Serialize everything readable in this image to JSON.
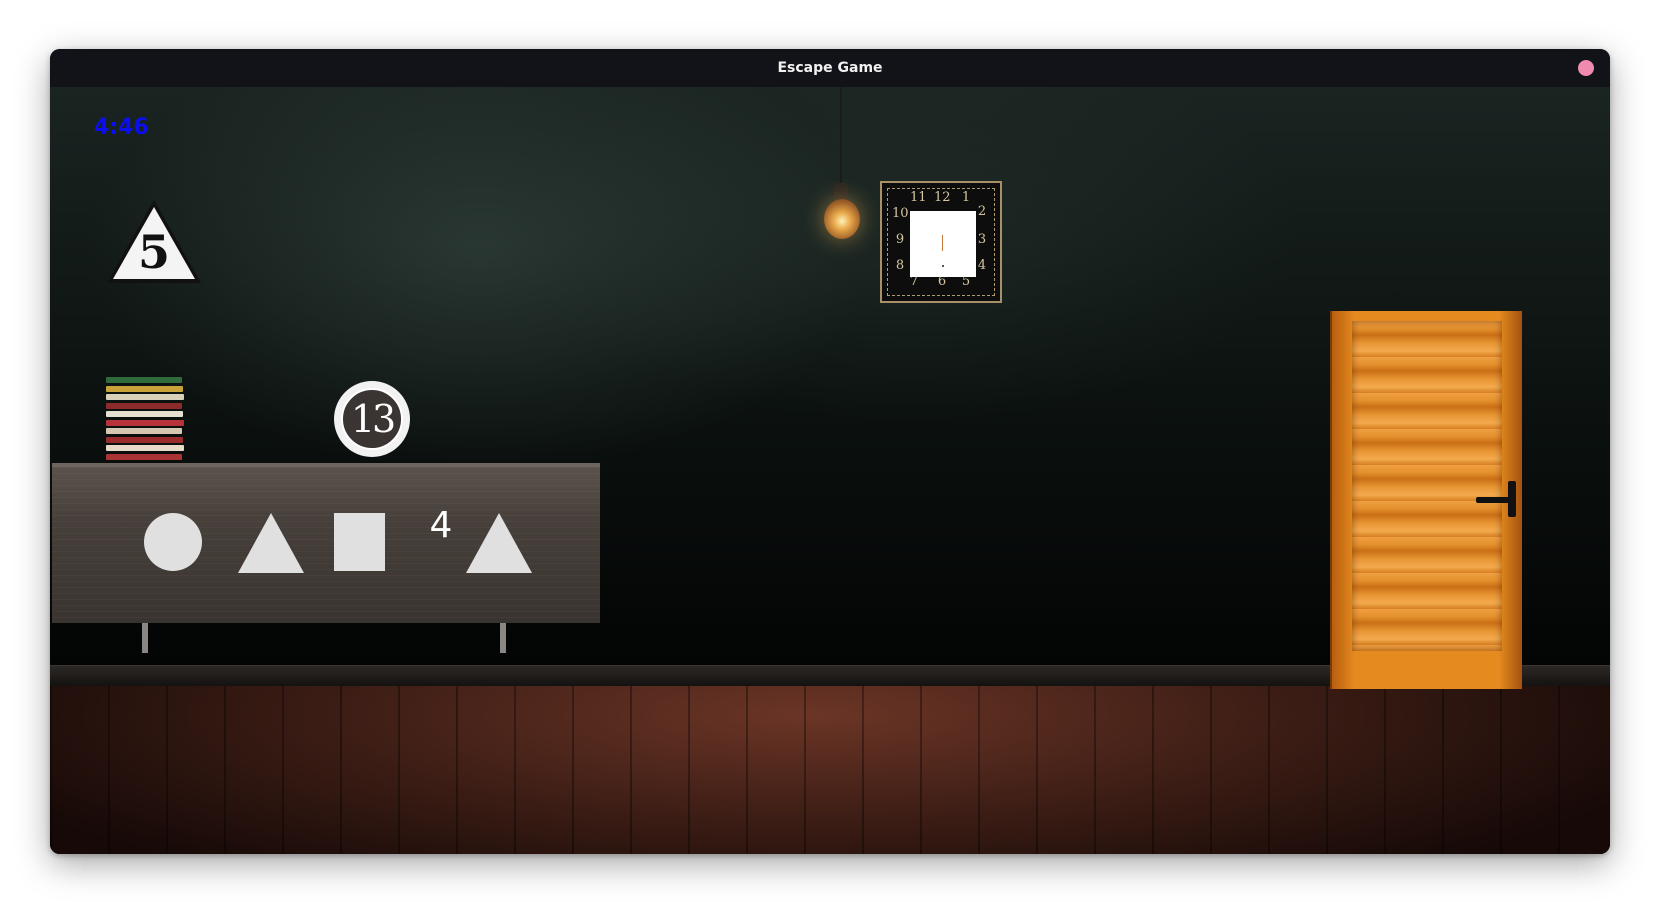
{
  "window": {
    "title": "Escape Game"
  },
  "hud": {
    "timer": "4:46"
  },
  "scene": {
    "triangle_sign_number": "5",
    "badge_number": "13",
    "cabinet_symbols": [
      {
        "kind": "circle"
      },
      {
        "kind": "triangle"
      },
      {
        "kind": "square"
      },
      {
        "kind": "number",
        "text": "4"
      },
      {
        "kind": "triangle"
      }
    ],
    "clock": {
      "numbers": [
        "12",
        "1",
        "2",
        "3",
        "4",
        "5",
        "6",
        "7",
        "8",
        "9",
        "10",
        "11"
      ]
    },
    "books_colors": [
      "#2f6b3c",
      "#c9a23a",
      "#d8d0b8",
      "#8d2a2a",
      "#e6e0d0",
      "#b8323a",
      "#d6c8b0",
      "#9b2c2c",
      "#e8dcc8",
      "#a33"
    ]
  },
  "colors": {
    "timer": "#0a0ef0",
    "door": "#e48a1e",
    "close_button": "#f08bb0"
  }
}
